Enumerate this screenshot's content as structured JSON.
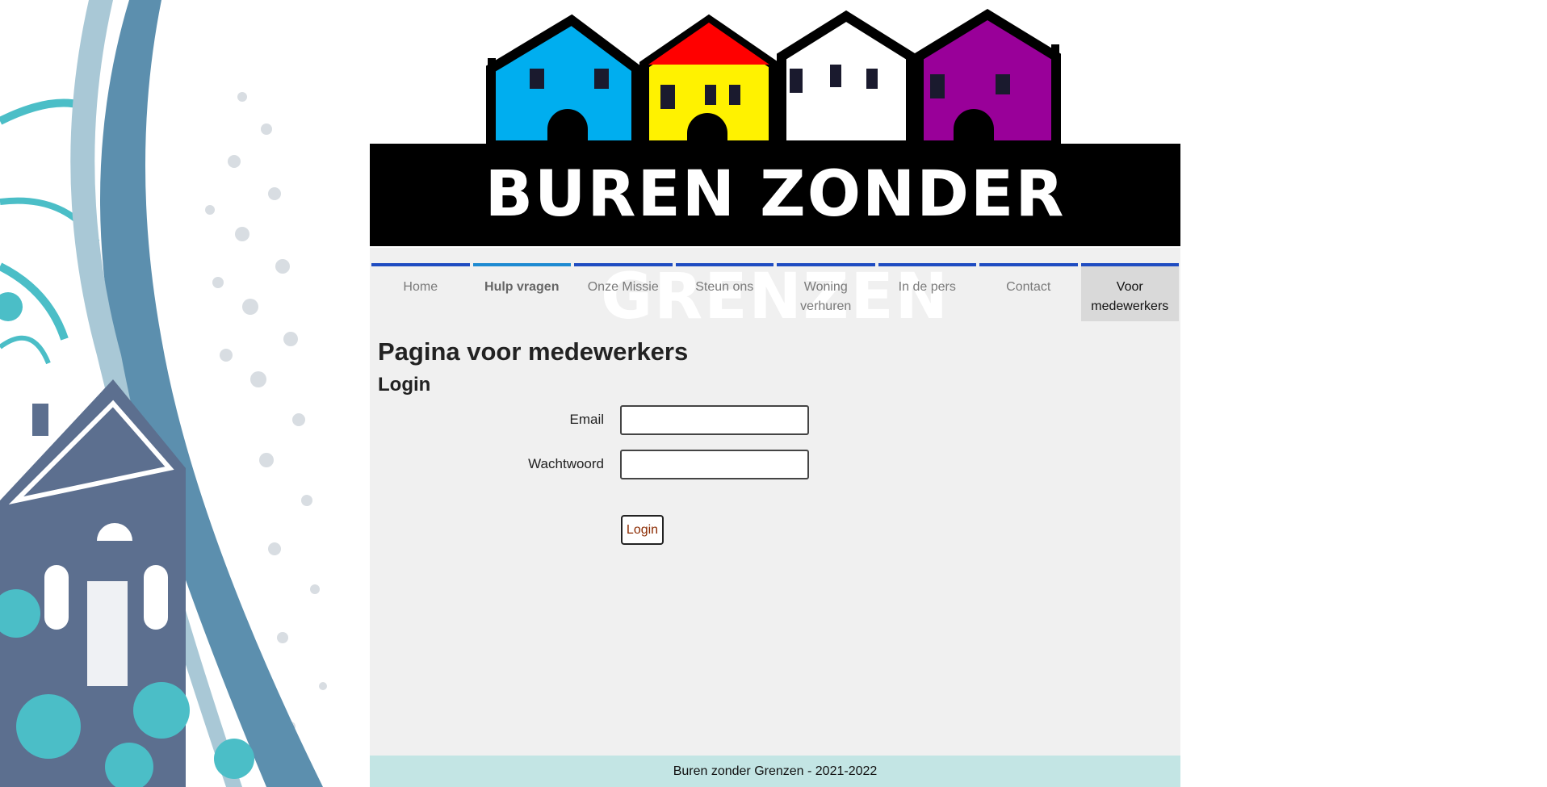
{
  "banner": {
    "logo_text": "BUREN ZONDER GRENZEN",
    "house_colors": [
      "#00aeef",
      "#fff200",
      "#ffffff",
      "#990099"
    ],
    "roof_accent": "#ff0000"
  },
  "nav": {
    "items": [
      {
        "label": "Home"
      },
      {
        "label": "Hulp vragen"
      },
      {
        "label": "Onze Missie"
      },
      {
        "label": "Steun ons"
      },
      {
        "label": "Woning verhuren"
      },
      {
        "label": "In de pers"
      },
      {
        "label": "Contact"
      },
      {
        "label": "Voor medewerkers"
      }
    ]
  },
  "main": {
    "title": "Pagina voor medewerkers",
    "subtitle": "Login"
  },
  "form": {
    "email_label": "Email",
    "email_value": "",
    "password_label": "Wachtwoord",
    "password_value": "",
    "submit_label": "Login"
  },
  "footer": {
    "text": "Buren zonder Grenzen - 2021-2022"
  },
  "colors": {
    "nav_border": "#1f4cc1",
    "content_bg": "#f0f0f0",
    "footer_bg": "#c3e5e4",
    "button_text": "#8b2a00"
  }
}
